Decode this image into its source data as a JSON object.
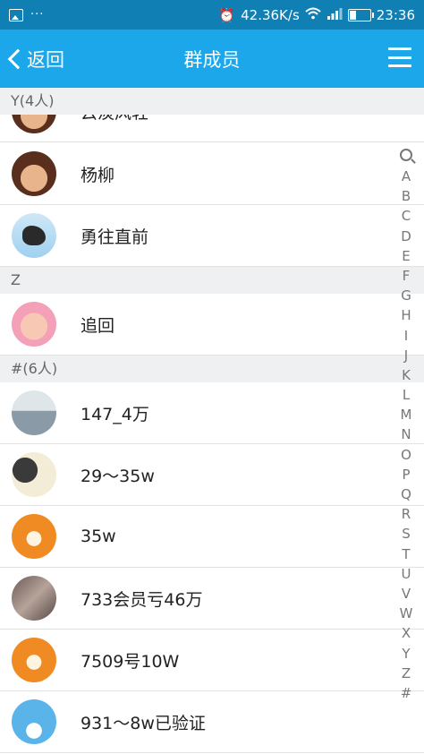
{
  "status_bar": {
    "speed": "42.36K/s",
    "time": "23:36",
    "left_icons": [
      "image-icon",
      "more-dots-icon"
    ],
    "right_icons": [
      "alarm-icon",
      "wifi-icon",
      "signal-icon",
      "battery-icon"
    ],
    "battery_level": 0.3
  },
  "header": {
    "back_label": "返回",
    "title": "群成员",
    "menu_icon": "hamburger-menu-icon",
    "bg_color": "#1ca7ea"
  },
  "list": {
    "sections": [
      {
        "header": "Y(4人)",
        "members": [
          {
            "name": "云淡风轻",
            "avatar": "cartoon"
          },
          {
            "name": "杨柳",
            "avatar": "cartoon"
          },
          {
            "name": "勇往直前",
            "avatar": "horse"
          }
        ]
      },
      {
        "header": "Z",
        "members": [
          {
            "name": "追回",
            "avatar": "baby"
          }
        ]
      },
      {
        "header": "#(6人)",
        "members": [
          {
            "name": "147_4万",
            "avatar": "station"
          },
          {
            "name": "29～35w",
            "avatar": "girl"
          },
          {
            "name": "35w",
            "avatar": "tiger"
          },
          {
            "name": "733会员亏46万",
            "avatar": "crowd"
          },
          {
            "name": "7509号10W",
            "avatar": "tiger"
          },
          {
            "name": "931～8w已验证",
            "avatar": "sky"
          }
        ]
      }
    ]
  },
  "index_bar": {
    "search_icon": "search-icon",
    "letters": [
      "A",
      "B",
      "C",
      "D",
      "E",
      "F",
      "G",
      "H",
      "I",
      "J",
      "K",
      "L",
      "M",
      "N",
      "O",
      "P",
      "Q",
      "R",
      "S",
      "T",
      "U",
      "V",
      "W",
      "X",
      "Y",
      "Z",
      "#"
    ]
  }
}
